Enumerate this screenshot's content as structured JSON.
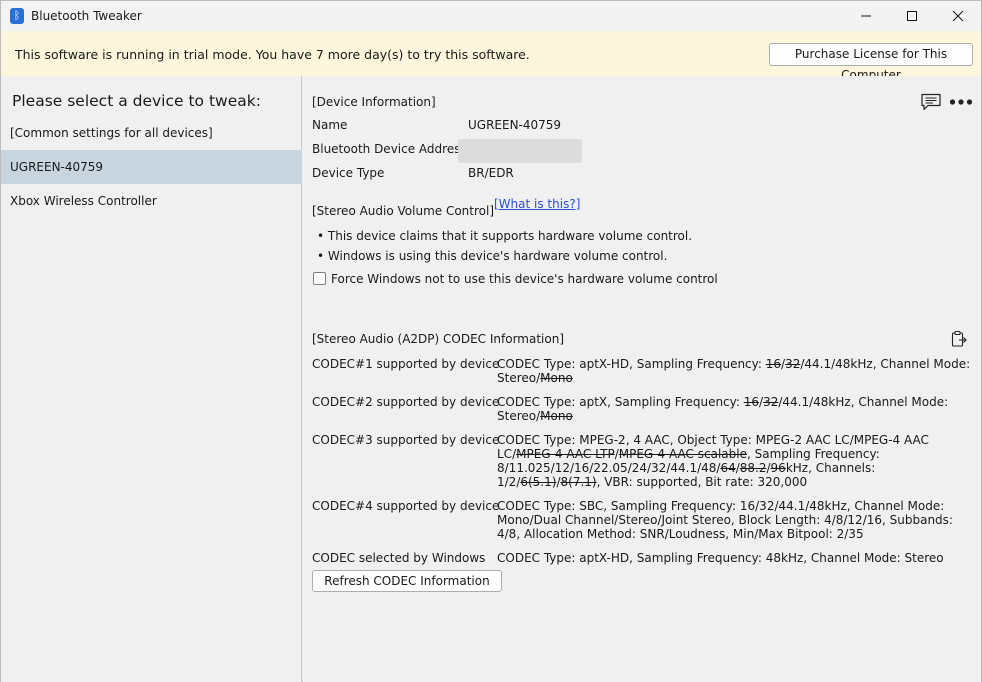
{
  "window": {
    "title": "Bluetooth Tweaker",
    "app_icon": "bluetooth-icon"
  },
  "trial": {
    "message": "This software is running in trial mode. You have 7 more day(s) to try this software.",
    "license_button": "Purchase License for This Computer"
  },
  "sidebar": {
    "heading": "Please select a device to tweak:",
    "items": [
      {
        "label": "[Common settings for all devices]"
      },
      {
        "label": "UGREEN-40759",
        "selected": true
      },
      {
        "label": "Xbox Wireless Controller"
      }
    ]
  },
  "device_info": {
    "section_title": "[Device Information]",
    "name_label": "Name",
    "name_value": "UGREEN-40759",
    "address_label": "Bluetooth Device Address",
    "type_label": "Device Type",
    "type_value": "BR/EDR"
  },
  "volume": {
    "section_title": "[Stereo Audio Volume Control]",
    "link": "[What is this?]",
    "bullet1": "This device claims that it supports hardware volume control.",
    "bullet2": "Windows is using this device's hardware volume control.",
    "checkbox_label": "Force Windows not to use this device's hardware volume control",
    "checkbox_checked": false
  },
  "codec": {
    "section_title": "[Stereo Audio (A2DP) CODEC Information]",
    "c1_label": "CODEC#1 supported by device",
    "c1_a": "CODEC Type: aptX-HD, Sampling Frequency: ",
    "c1_s1": "16",
    "c1_sep": "/",
    "c1_s2": "32",
    "c1_b": "/44.1/48kHz, Channel Mode: Stereo/",
    "c1_s3": "Mono",
    "c2_label": "CODEC#2 supported by device",
    "c2_a": "CODEC Type: aptX, Sampling Frequency: ",
    "c2_s1": "16",
    "c2_sep": "/",
    "c2_s2": "32",
    "c2_b": "/44.1/48kHz, Channel Mode: Stereo/",
    "c2_s3": "Mono",
    "c3_label": "CODEC#3 supported by device",
    "c3_a": "CODEC Type: MPEG-2, 4 AAC, Object Type: MPEG-2 AAC LC/MPEG-4 AAC LC/",
    "c3_s1": "MPEG-4 AAC LTP",
    "c3_sep1": "/",
    "c3_s2": "MPEG-4 AAC scalable",
    "c3_b": ", Sampling Frequency: 8/11.025/12/16/22.05/24/32/44.1/48/",
    "c3_s3": "64",
    "c3_sep2": "/",
    "c3_s4": "88.2",
    "c3_sep3": "/",
    "c3_s5": "96",
    "c3_c": "kHz, Channels: 1/2/",
    "c3_s6": "6(5.1)",
    "c3_sep4": "/",
    "c3_s7": "8(7.1)",
    "c3_d": ", VBR: supported, Bit rate: 320,000",
    "c4_label": "CODEC#4 supported by device",
    "c4_value": "CODEC Type: SBC, Sampling Frequency: 16/32/44.1/48kHz, Channel Mode: Mono/Dual Channel/Stereo/Joint Stereo, Block Length: 4/8/12/16, Subbands: 4/8, Allocation Method: SNR/Loudness, Min/Max Bitpool: 2/35",
    "selected_label": "CODEC selected by Windows",
    "selected_value": "CODEC Type: aptX-HD, Sampling Frequency: 48kHz, Channel Mode: Stereo",
    "refresh_button": "Refresh CODEC Information"
  }
}
